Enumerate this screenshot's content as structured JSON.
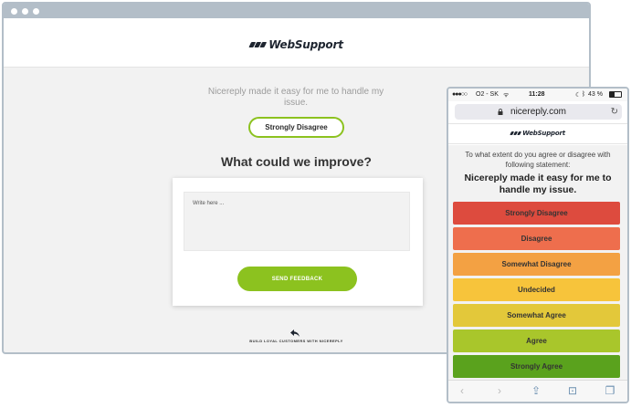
{
  "desktop": {
    "brand": "WebSupport",
    "statement": "Nicereply made it easy for me to handle my issue.",
    "selected_answer": "Strongly Disagree",
    "question": "What could we improve?",
    "textarea_placeholder": "Write here ...",
    "send_button": "SEND FEEDBACK",
    "footer_text": "BUILD LOYAL CUSTOMERS WITH NICEREPLY"
  },
  "phone": {
    "status": {
      "carrier": "O2 - SK",
      "time": "11:28",
      "battery": "43 %"
    },
    "url": "nicereply.com",
    "brand": "WebSupport",
    "intro": "To what extent do you agree or disagree with following statement:",
    "statement": "Nicereply made it easy for me to handle my issue.",
    "options": [
      {
        "label": "Strongly Disagree",
        "color": "#dd4b3e"
      },
      {
        "label": "Disagree",
        "color": "#ee6e4d"
      },
      {
        "label": "Somewhat Disagree",
        "color": "#f3a143"
      },
      {
        "label": "Undecided",
        "color": "#f7c43b"
      },
      {
        "label": "Somewhat Agree",
        "color": "#e3c83a"
      },
      {
        "label": "Agree",
        "color": "#a9c62b"
      },
      {
        "label": "Strongly Agree",
        "color": "#5aa21d"
      }
    ],
    "toolbar_icons": [
      "back-icon",
      "forward-icon",
      "share-icon",
      "bookmarks-icon",
      "tabs-icon"
    ]
  },
  "colors": {
    "accent_green": "#8cc21f",
    "frame": "#b3bec8",
    "page_bg": "#f2f2f2"
  }
}
